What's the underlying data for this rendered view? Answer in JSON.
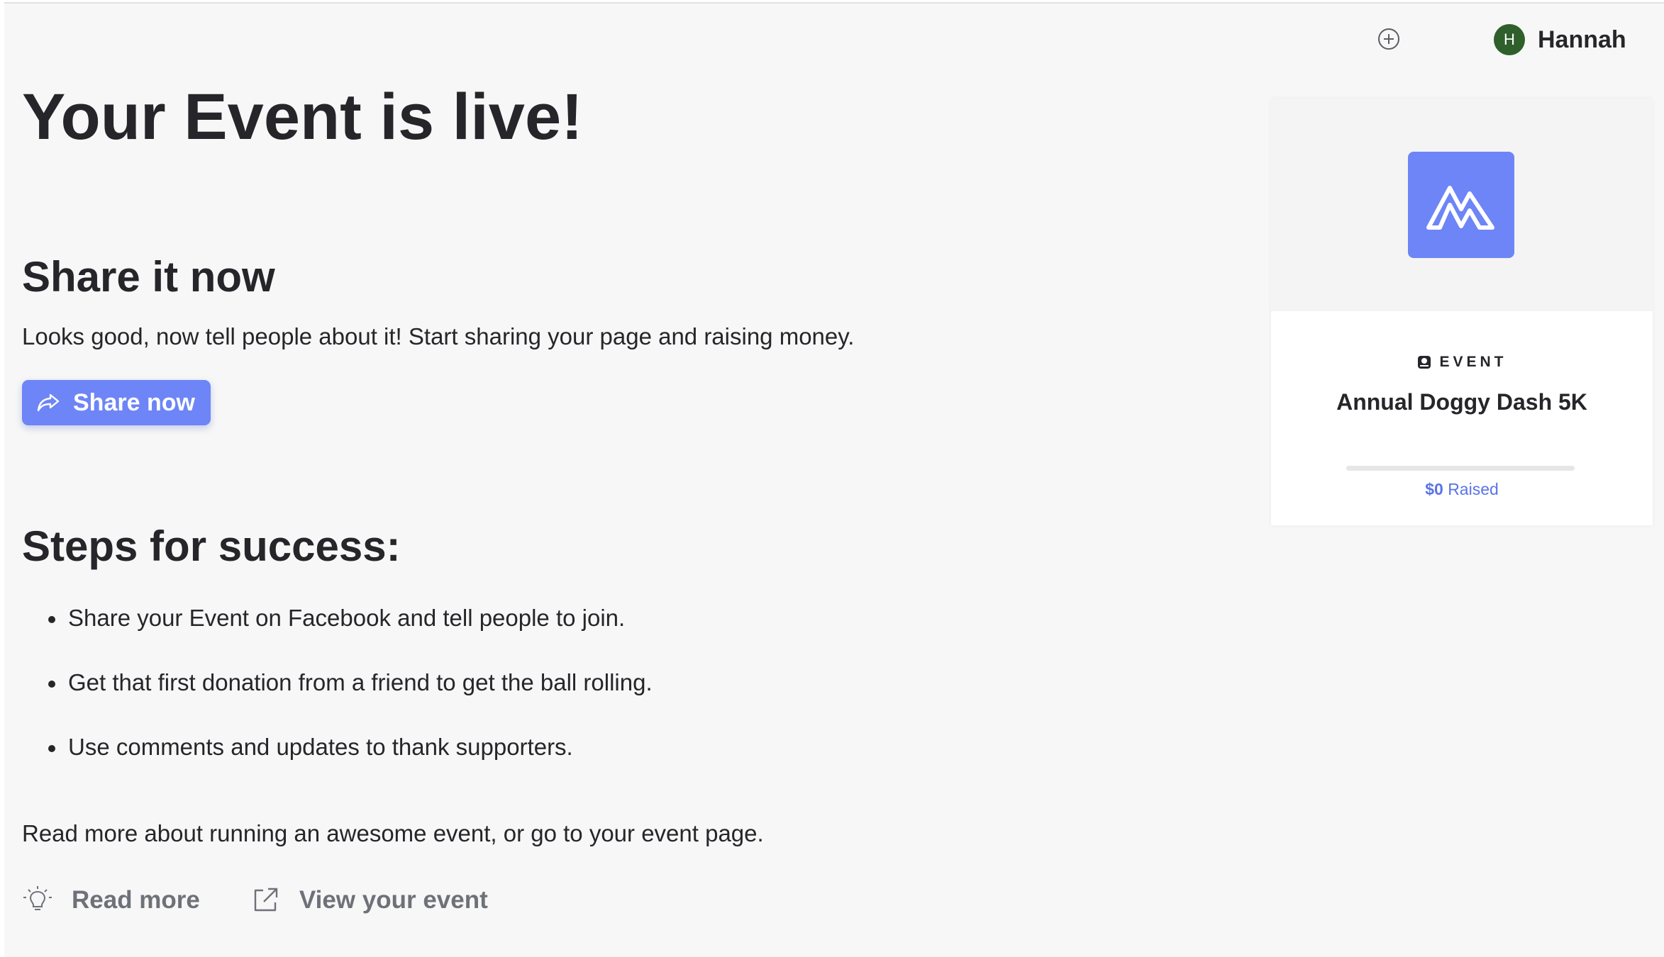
{
  "header": {
    "add_icon": "plus-circle-icon",
    "user": {
      "initial": "H",
      "name": "Hannah",
      "avatar_color": "#2f5f2b"
    }
  },
  "main": {
    "title": "Your Event is live!",
    "share": {
      "heading": "Share it now",
      "text": "Looks good, now tell people about it! Start sharing your page and raising money.",
      "button_label": "Share now",
      "button_icon": "share-arrow-icon"
    },
    "steps": {
      "heading": "Steps for success:",
      "items": [
        "Share your Event on Facebook and tell people to join.",
        "Get that first donation from a friend to get the ball rolling.",
        "Use comments and updates to thank supporters."
      ]
    },
    "read_text": "Read more about running an awesome event, or go to your event page.",
    "links": {
      "read_more": {
        "label": "Read more",
        "icon": "lightbulb-icon"
      },
      "view_event": {
        "label": "View your event",
        "icon": "external-link-icon"
      }
    }
  },
  "card": {
    "logo_icon": "mountain-logo-icon",
    "type_label": "EVENT",
    "type_icon": "badge-icon",
    "title": "Annual Doggy Dash 5K",
    "progress": 0,
    "raised_amount": "$0",
    "raised_label": "Raised"
  },
  "colors": {
    "accent": "#6d85f6",
    "accent_text": "#5a73e6",
    "text": "#26262a",
    "muted": "#6f7179",
    "background": "#f7f7f7"
  }
}
